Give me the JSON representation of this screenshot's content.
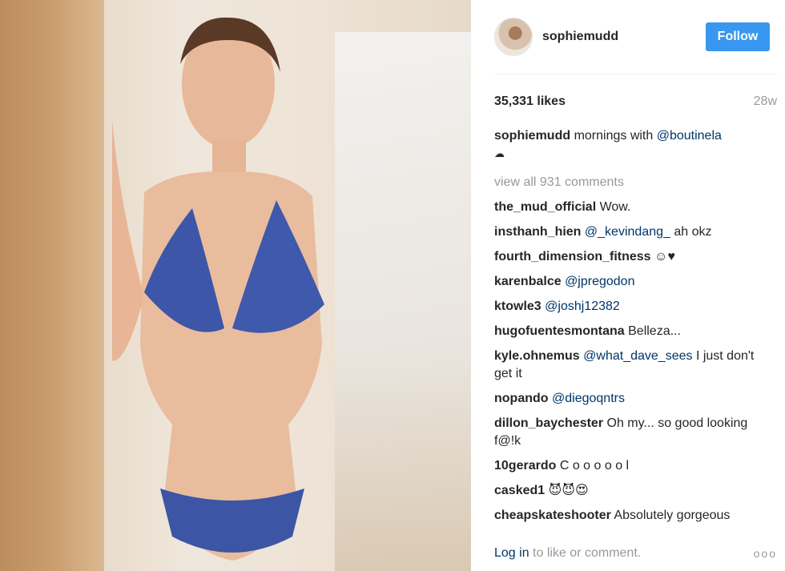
{
  "header": {
    "username": "sophiemudd",
    "follow_label": "Follow"
  },
  "stats": {
    "likes": "35,331 likes",
    "age": "28w"
  },
  "caption": {
    "username": "sophiemudd",
    "text": "mornings with",
    "mention": "@boutinela",
    "emoji": "☁"
  },
  "view_all": "view all 931 comments",
  "comments": [
    {
      "user": "the_mud_official",
      "text": "Wow.",
      "mention": ""
    },
    {
      "user": "insthanh_hien",
      "text": "ah okz",
      "mention": "@_kevindang_"
    },
    {
      "user": "fourth_dimension_fitness",
      "text": "☺♥",
      "mention": ""
    },
    {
      "user": "karenbalce",
      "text": "",
      "mention": "@jpregodon"
    },
    {
      "user": "ktowle3",
      "text": "",
      "mention": "@joshj12382"
    },
    {
      "user": "hugofuentesmontana",
      "text": "Belleza...",
      "mention": ""
    },
    {
      "user": "kyle.ohnemus",
      "text": "I just don't get it",
      "mention": "@what_dave_sees"
    },
    {
      "user": "nopando",
      "text": "",
      "mention": "@diegoqntrs"
    },
    {
      "user": "dillon_baychester",
      "text": "Oh my... so good looking f@!k",
      "mention": ""
    },
    {
      "user": "10gerardo",
      "text": "C o o o o o l",
      "mention": ""
    },
    {
      "user": "casked1",
      "text": "😈😈😍",
      "mention": ""
    },
    {
      "user": "cheapskateshooter",
      "text": "Absolutely gorgeous",
      "mention": ""
    }
  ],
  "footer": {
    "login_label": "Log in",
    "rest": "to like or comment.",
    "more": "ooo"
  }
}
